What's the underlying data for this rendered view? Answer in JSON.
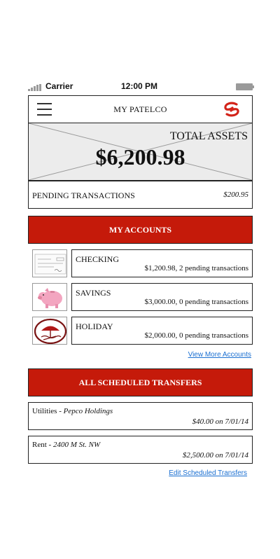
{
  "status_bar": {
    "carrier": "Carrier",
    "time": "12:00 PM"
  },
  "header": {
    "title": "MY PATELCO"
  },
  "summary": {
    "total_label": "TOTAL ASSETS",
    "total_amount": "$6,200.98",
    "pending_label": "PENDING TRANSACTIONS",
    "pending_amount": "$200.95"
  },
  "accounts": {
    "section_label": "MY ACCOUNTS",
    "items": [
      {
        "name": "CHECKING",
        "detail": "$1,200.98, 2 pending transactions",
        "icon": "check-image-icon"
      },
      {
        "name": "SAVINGS",
        "detail": "$3,000.00, 0 pending transactions",
        "icon": "piggy-bank-icon"
      },
      {
        "name": "HOLIDAY",
        "detail": "$2,000.00, 0 pending transactions",
        "icon": "beach-umbrella-icon"
      }
    ],
    "more_link": "View More Accounts"
  },
  "transfers": {
    "section_label": "ALL SCHEDULED TRANSFERS",
    "items": [
      {
        "label": "Utilities - ",
        "payee": "Pepco Holdings",
        "amount_date": "$40.00 on 7/01/14"
      },
      {
        "label": "Rent - ",
        "payee": "2400 M St. NW",
        "amount_date": "$2,500.00 on 7/01/14"
      }
    ],
    "edit_link": "Edit Scheduled Transfers"
  },
  "colors": {
    "accent": "#c51a0a",
    "link": "#1a6fd1",
    "placeholder": "#ececec"
  }
}
